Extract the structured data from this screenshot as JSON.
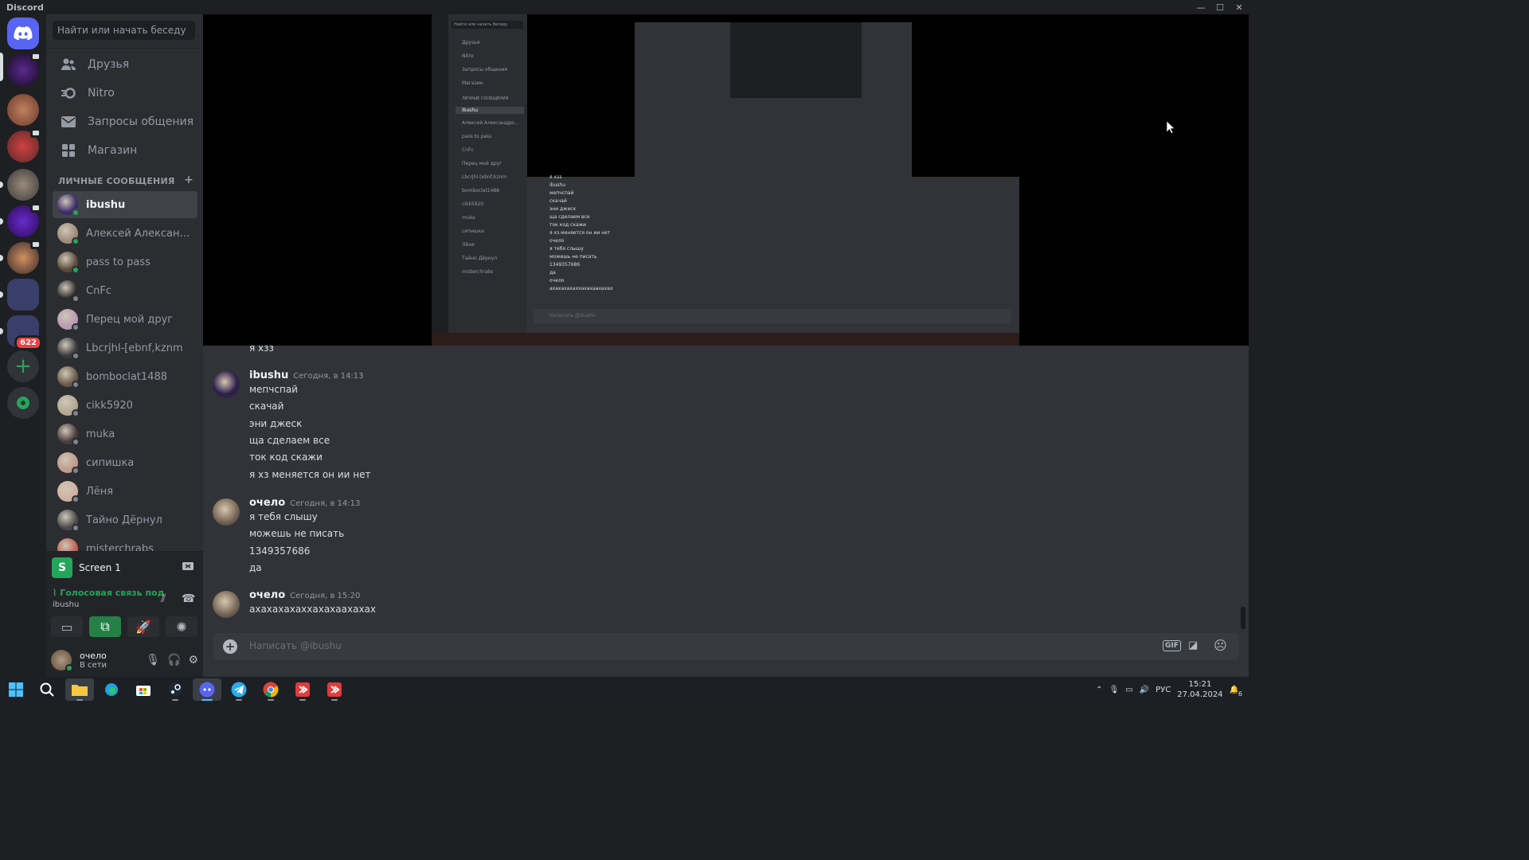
{
  "window": {
    "title": "Discord"
  },
  "guilds": {
    "badge": "622"
  },
  "sidebar": {
    "search_placeholder": "Найти или начать беседу",
    "nav": [
      {
        "label": "Друзья",
        "icon": "friends-icon"
      },
      {
        "label": "Nitro",
        "icon": "nitro-icon"
      },
      {
        "label": "Запросы общения",
        "icon": "mail-icon"
      },
      {
        "label": "Магазин",
        "icon": "shop-icon"
      }
    ],
    "dm_header": "ЛИЧНЫЕ СООБЩЕНИЯ",
    "dms": [
      {
        "name": "ibushu",
        "active": true,
        "online": true,
        "color": "#3a2a6a"
      },
      {
        "name": "Алексей Александро...",
        "online": true,
        "color": "#a08a7a"
      },
      {
        "name": "pass to pass",
        "online": true,
        "color": "#5a4a3a"
      },
      {
        "name": "CnFc",
        "online": false,
        "color": "#2a2a2a"
      },
      {
        "name": "Перец мой друг",
        "online": false,
        "color": "#b89ab0"
      },
      {
        "name": "Lbcrjhl-[ebnf,kznm",
        "online": false,
        "color": "#3a3a3a"
      },
      {
        "name": "bomboclat1488",
        "online": false,
        "color": "#6a5a4a"
      },
      {
        "name": "cikk5920",
        "online": false,
        "color": "#b0a890"
      },
      {
        "name": "muka",
        "online": false,
        "color": "#4a3a3a"
      },
      {
        "name": "сипишка",
        "online": false,
        "color": "#c09a8a"
      },
      {
        "name": "Лёня",
        "online": false,
        "color": "#d0b0a0"
      },
      {
        "name": "Тайно Дёрнул",
        "online": false,
        "color": "#4a4a4a"
      },
      {
        "name": "misterchrabs",
        "online": false,
        "color": "#c06050"
      }
    ],
    "screen_label": "Screen 1",
    "screen_letter": "S",
    "voice_status": "Голосовая связь под",
    "voice_channel": "ibushu",
    "user": {
      "name": "очело",
      "status": "В сети"
    }
  },
  "stream_preview": {
    "search": "Найти или начать беседу",
    "nav": [
      "Друзья",
      "Nitro",
      "Запросы общения",
      "Магазин"
    ],
    "dm_header": "ЛИЧНЫЕ СООБЩЕНИЯ",
    "dms": [
      "ibushu",
      "Алексей Александро...",
      "pass to pass",
      "CnFc",
      "Перец мой друг",
      "Lbcrjhl-[ebnf,kznm",
      "bomboclat1488",
      "cikk5920",
      "muka",
      "сипишка",
      "Лёня",
      "Тайно Дёрнул",
      "misterchrabs"
    ],
    "input": "Написать @ibushu",
    "messages": [
      "я хзз",
      "ibushu",
      "мепчспай",
      "скачай",
      "эни джеск",
      "ща сделаем все",
      "ток код скажи",
      "я хз меняется он ии нет",
      "очело",
      "я тебя слышу",
      "можешь не писать",
      "1349357686",
      "да",
      "очело",
      "ахахахахаххахахаахахах"
    ]
  },
  "messages": {
    "truncated_top": "я хзз",
    "groups": [
      {
        "author": "ibushu",
        "time": "Сегодня, в 14:13",
        "avatar_color": "#2d1f4d",
        "lines": [
          "мепчспай",
          "скачай",
          "эни джеск",
          "ща сделаем все",
          "ток код скажи",
          "я хз меняется он ии нет"
        ]
      },
      {
        "author": "очело",
        "time": "Сегодня, в 14:13",
        "avatar_color": "#7a6a5a",
        "lines": [
          "я тебя слышу",
          "можешь не писать",
          "1349357686",
          "да"
        ]
      },
      {
        "author": "очело",
        "time": "Сегодня, в 15:20",
        "avatar_color": "#7a6a5a",
        "lines": [
          "ахахахахаххахахаахахах"
        ]
      }
    ]
  },
  "composer": {
    "placeholder": "Написать @ibushu",
    "gif_label": "GIF"
  },
  "taskbar": {
    "language": "РУС",
    "time": "15:21",
    "date": "27.04.2024",
    "notif_count": "6"
  }
}
